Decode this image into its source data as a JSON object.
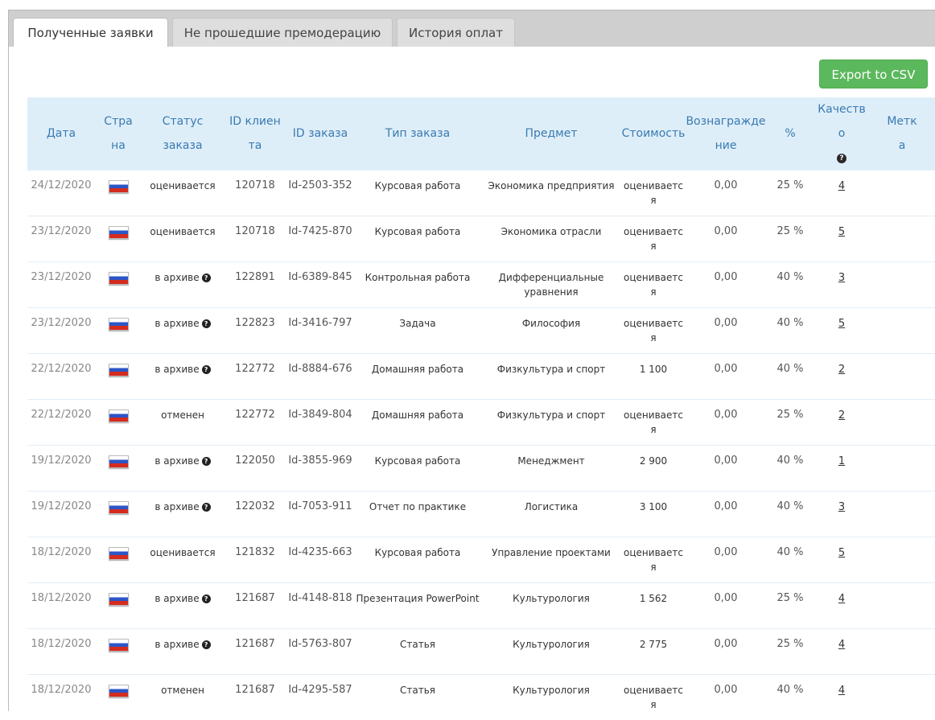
{
  "tabs": [
    {
      "label": "Полученные заявки",
      "active": true
    },
    {
      "label": "Не прошедшие премодерацию",
      "active": false
    },
    {
      "label": "История оплат",
      "active": false
    }
  ],
  "export_label": "Export to CSV",
  "colors": {
    "accent": "#5cb85c",
    "header_bg": "#deeef9",
    "header_text": "#3a7ab0"
  },
  "columns": [
    "Дата",
    "Страна",
    "Статус заказа",
    "ID клиента",
    "ID заказа",
    "Тип заказа",
    "Предмет",
    "Стоимость",
    "Вознаграждение",
    "%",
    "Качество",
    "Метка"
  ],
  "rows": [
    {
      "date": "24/12/2020",
      "country": "russia-flag",
      "status": "оценивается",
      "status_help": false,
      "client_id": "120718",
      "order_id": "Id-2503-352",
      "type": "Курсовая работа",
      "subject": "Экономика предприятия",
      "cost": "оценивается",
      "reward": "0,00",
      "percent": "25 %",
      "quality": "4",
      "mark": ""
    },
    {
      "date": "23/12/2020",
      "country": "russia-flag",
      "status": "оценивается",
      "status_help": false,
      "client_id": "120718",
      "order_id": "Id-7425-870",
      "type": "Курсовая работа",
      "subject": "Экономика отрасли",
      "cost": "оценивается",
      "reward": "0,00",
      "percent": "25 %",
      "quality": "5",
      "mark": ""
    },
    {
      "date": "23/12/2020",
      "country": "russia-flag",
      "status": "в архиве",
      "status_help": true,
      "client_id": "122891",
      "order_id": "Id-6389-845",
      "type": "Контрольная работа",
      "subject": "Дифференциальные уравнения",
      "cost": "оценивается",
      "reward": "0,00",
      "percent": "40 %",
      "quality": "3",
      "mark": ""
    },
    {
      "date": "23/12/2020",
      "country": "russia-flag",
      "status": "в архиве",
      "status_help": true,
      "client_id": "122823",
      "order_id": "Id-3416-797",
      "type": "Задача",
      "subject": "Философия",
      "cost": "оценивается",
      "reward": "0,00",
      "percent": "40 %",
      "quality": "5",
      "mark": ""
    },
    {
      "date": "22/12/2020",
      "country": "russia-flag",
      "status": "в архиве",
      "status_help": true,
      "client_id": "122772",
      "order_id": "Id-8884-676",
      "type": "Домашняя работа",
      "subject": "Физкультура и спорт",
      "cost": "1 100",
      "reward": "0,00",
      "percent": "40 %",
      "quality": "2",
      "mark": ""
    },
    {
      "date": "22/12/2020",
      "country": "russia-flag",
      "status": "отменен",
      "status_help": false,
      "client_id": "122772",
      "order_id": "Id-3849-804",
      "type": "Домашняя работа",
      "subject": "Физкультура и спорт",
      "cost": "оценивается",
      "reward": "0,00",
      "percent": "25 %",
      "quality": "2",
      "mark": ""
    },
    {
      "date": "19/12/2020",
      "country": "russia-flag",
      "status": "в архиве",
      "status_help": true,
      "client_id": "122050",
      "order_id": "Id-3855-969",
      "type": "Курсовая работа",
      "subject": "Менеджмент",
      "cost": "2 900",
      "reward": "0,00",
      "percent": "40 %",
      "quality": "1",
      "mark": ""
    },
    {
      "date": "19/12/2020",
      "country": "russia-flag",
      "status": "в архиве",
      "status_help": true,
      "client_id": "122032",
      "order_id": "Id-7053-911",
      "type": "Отчет по практике",
      "subject": "Логистика",
      "cost": "3 100",
      "reward": "0,00",
      "percent": "40 %",
      "quality": "3",
      "mark": ""
    },
    {
      "date": "18/12/2020",
      "country": "russia-flag",
      "status": "оценивается",
      "status_help": false,
      "client_id": "121832",
      "order_id": "Id-4235-663",
      "type": "Курсовая работа",
      "subject": "Управление проектами",
      "cost": "оценивается",
      "reward": "0,00",
      "percent": "40 %",
      "quality": "5",
      "mark": ""
    },
    {
      "date": "18/12/2020",
      "country": "russia-flag",
      "status": "в архиве",
      "status_help": true,
      "client_id": "121687",
      "order_id": "Id-4148-818",
      "type": "Презентация PowerPoint",
      "subject": "Культурология",
      "cost": "1 562",
      "reward": "0,00",
      "percent": "25 %",
      "quality": "4",
      "mark": ""
    },
    {
      "date": "18/12/2020",
      "country": "russia-flag",
      "status": "в архиве",
      "status_help": true,
      "client_id": "121687",
      "order_id": "Id-5763-807",
      "type": "Статья",
      "subject": "Культурология",
      "cost": "2 775",
      "reward": "0,00",
      "percent": "25 %",
      "quality": "4",
      "mark": ""
    },
    {
      "date": "18/12/2020",
      "country": "russia-flag",
      "status": "отменен",
      "status_help": false,
      "client_id": "121687",
      "order_id": "Id-4295-587",
      "type": "Статья",
      "subject": "Культурология",
      "cost": "оценивается",
      "reward": "0,00",
      "percent": "40 %",
      "quality": "4",
      "mark": ""
    }
  ]
}
